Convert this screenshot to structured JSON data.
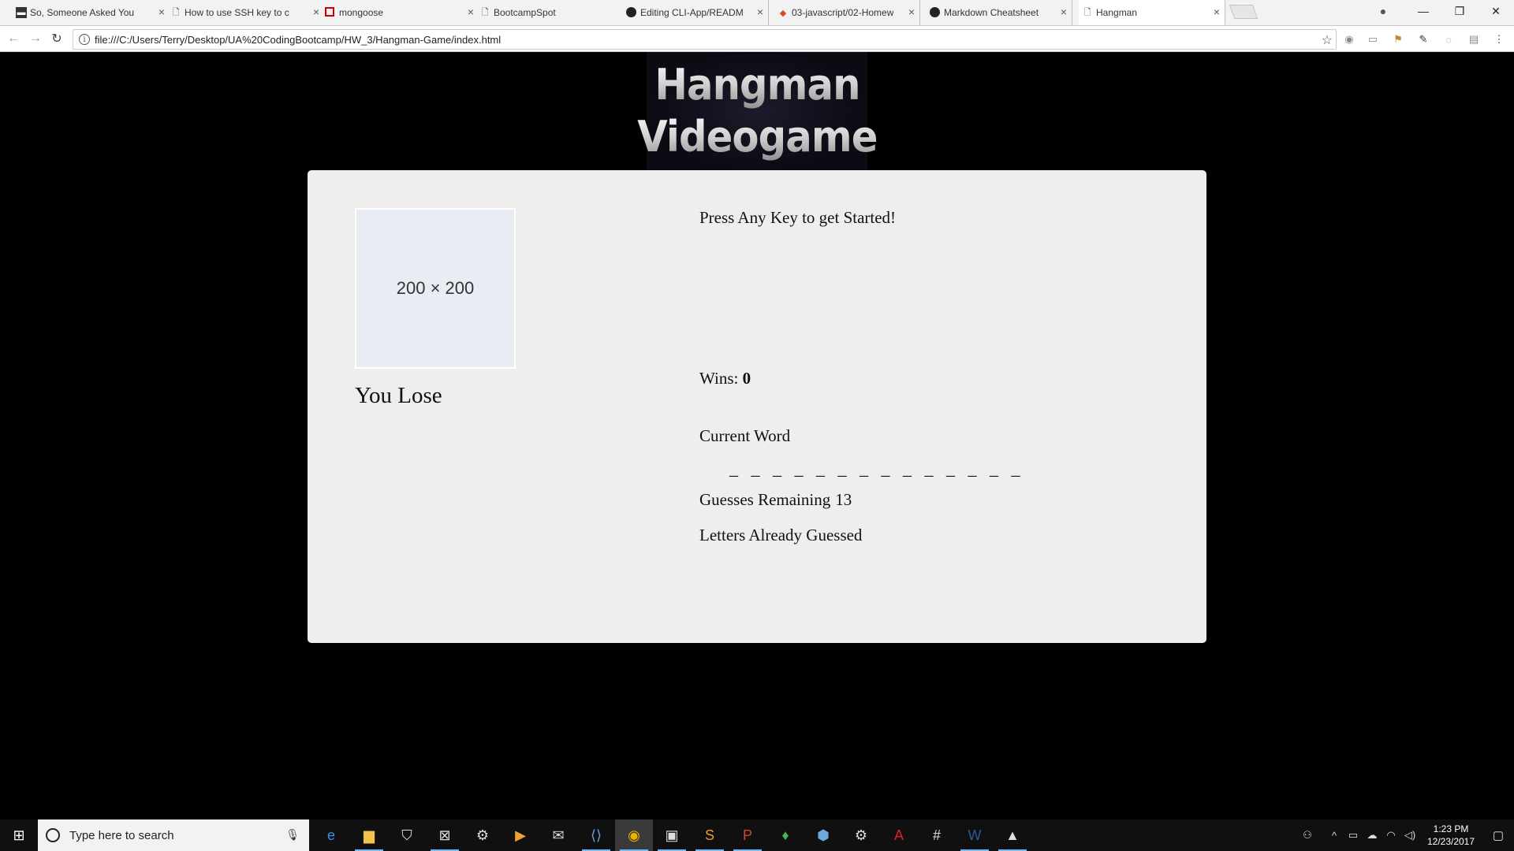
{
  "browser": {
    "tabs": [
      {
        "title": "So, Someone Asked You",
        "favicon": "doc-icon"
      },
      {
        "title": "How to use SSH key to c",
        "favicon": "page-icon"
      },
      {
        "title": "mongoose",
        "favicon": "mongoose-icon"
      },
      {
        "title": "BootcampSpot",
        "favicon": "page-icon"
      },
      {
        "title": "Editing CLI-App/READM",
        "favicon": "github-icon"
      },
      {
        "title": "03-javascript/02-Homew",
        "favicon": "gitlab-icon"
      },
      {
        "title": "Markdown Cheatsheet",
        "favicon": "github-icon"
      },
      {
        "title": "Hangman",
        "favicon": "page-icon"
      }
    ],
    "active_tab": 7,
    "url": "file:///C:/Users/Terry/Desktop/UA%20CodingBootcamp/HW_3/Hangman-Game/index.html"
  },
  "page": {
    "logo_line1": "Hangman",
    "logo_line2": "Videogame",
    "placeholder_text": "200 × 200",
    "result": "You Lose",
    "prompt": "Press Any Key to get Started!",
    "wins_label": "Wins:",
    "wins_value": "0",
    "current_word_label": "Current Word",
    "current_word": "_ _ _ _ _ _ _ _ _ _ _ _ _ _",
    "guesses_label": "Guesses Remaining",
    "guesses_value": "13",
    "letters_label": "Letters Already Guessed"
  },
  "taskbar": {
    "search_placeholder": "Type here to search",
    "clock_time": "1:23 PM",
    "clock_date": "12/23/2017"
  }
}
